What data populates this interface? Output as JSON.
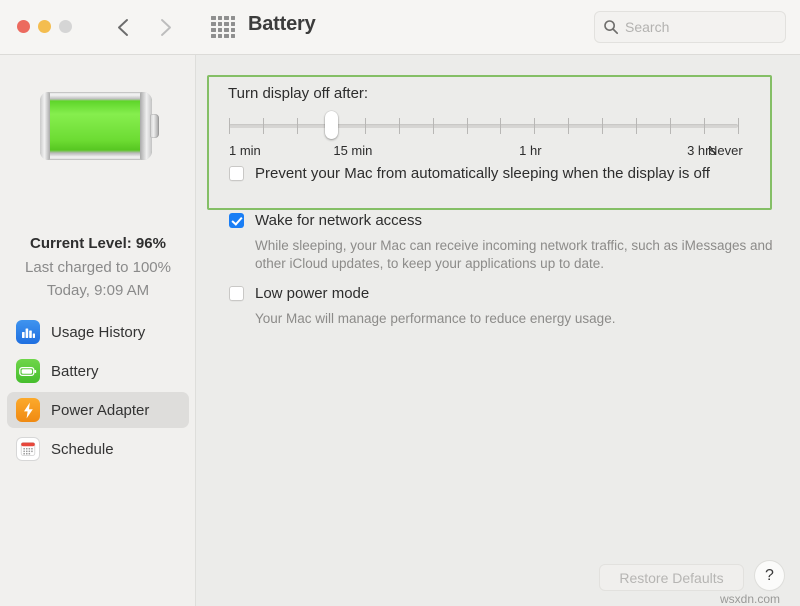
{
  "window": {
    "title": "Battery",
    "traffic_lights": [
      "close",
      "minimize",
      "zoom"
    ],
    "back_label": "Back",
    "forward_label": "Forward",
    "grid_label": "Show All",
    "colors": {
      "close": "#ec6a5f",
      "minimize": "#f4bd4f",
      "zoom": "#d5d5d5",
      "accent_blue": "#1a7ef5",
      "highlight_green": "#84bf66",
      "adapter_orange": "#f08a12",
      "battery_green": "#6ddc33"
    }
  },
  "search": {
    "placeholder": "Search",
    "value": "",
    "icon": "search-icon"
  },
  "sidebar": {
    "battery_icon": "battery-full-icon",
    "current_level": "Current Level: 96%",
    "last_charged": "Last charged to 100%",
    "charge_time": "Today, 9:09 AM",
    "items": [
      {
        "label": "Usage History",
        "icon": "bar-chart-icon",
        "selected": false
      },
      {
        "label": "Battery",
        "icon": "battery-icon",
        "selected": false
      },
      {
        "label": "Power Adapter",
        "icon": "lightning-bolt-icon",
        "selected": true
      },
      {
        "label": "Schedule",
        "icon": "calendar-icon",
        "selected": false
      }
    ]
  },
  "main": {
    "display_off_label": "Turn display off after:",
    "slider": {
      "tick_count": 16,
      "thumb_index": 3,
      "labels": [
        {
          "text": "1 min",
          "pos": 0
        },
        {
          "text": "15 min",
          "pos": 0.205
        },
        {
          "text": "1 hr",
          "pos": 0.57
        },
        {
          "text": "3 hrs",
          "pos": 0.9
        },
        {
          "text": "Never",
          "pos": 1.0
        }
      ]
    },
    "checkboxes": [
      {
        "label": "Prevent your Mac from automatically sleeping when the display is off",
        "checked": false,
        "description": ""
      },
      {
        "label": "Wake for network access",
        "checked": true,
        "description": "While sleeping, your Mac can receive incoming network traffic, such as iMessages and other iCloud updates, to keep your applications up to date."
      },
      {
        "label": "Low power mode",
        "checked": false,
        "description": "Your Mac will manage performance to reduce energy usage."
      }
    ],
    "restore_defaults": "Restore Defaults",
    "help": "?",
    "watermark": "wsxdn.com"
  }
}
